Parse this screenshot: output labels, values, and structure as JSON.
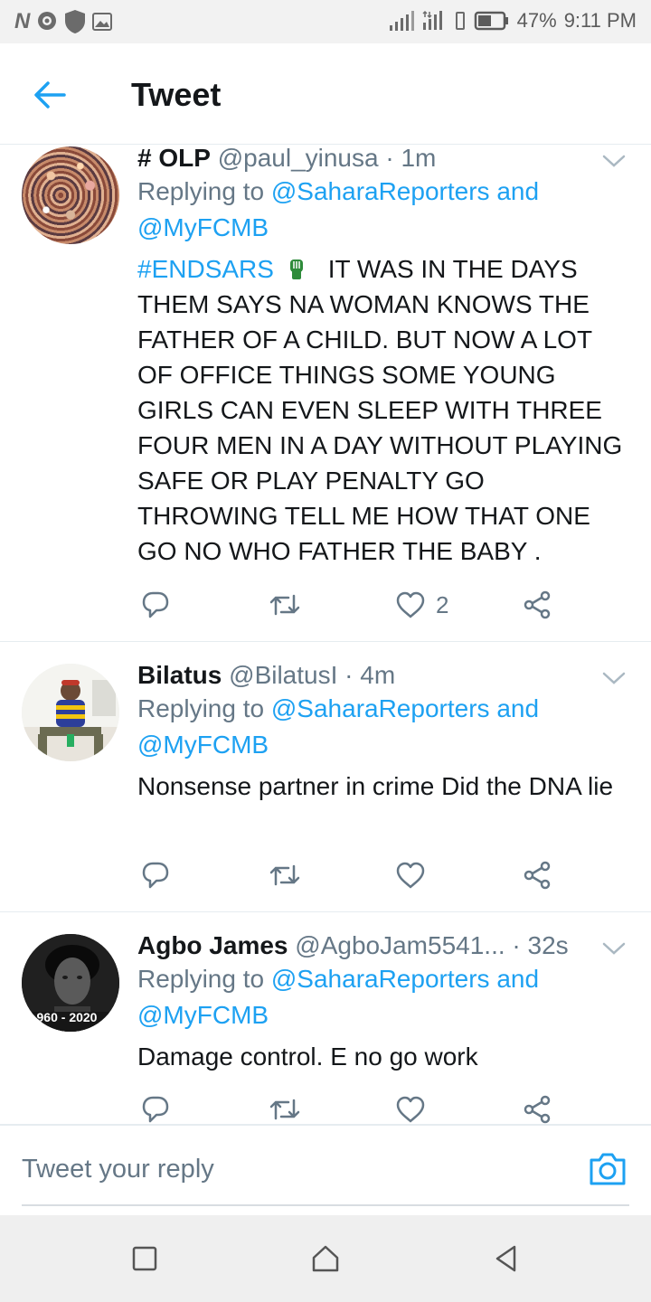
{
  "status_bar": {
    "n_label": "N",
    "battery": "47%",
    "time": "9:11 PM"
  },
  "header": {
    "title": "Tweet"
  },
  "tweets": [
    {
      "name": "# OLP",
      "handle": "@paul_yinusa",
      "separator": "·",
      "time": "1m",
      "replying_prefix": "Replying to",
      "replying_mention1": "@SaharaReporters",
      "replying_and": "and",
      "replying_mention2": "@MyFCMB",
      "hashtag": "#ENDSARS",
      "text": "IT WAS IN THE DAYS THEM SAYS NA WOMAN KNOWS THE FATHER OF A CHILD. BUT NOW A LOT OF OFFICE THINGS  SOME YOUNG GIRLS CAN EVEN SLEEP WITH THREE FOUR MEN  IN A DAY WITHOUT PLAYING SAFE OR PLAY PENALTY GO THROWING  TELL ME HOW THAT ONE GO NO WHO FATHER THE BABY .",
      "like_count": "2"
    },
    {
      "name": "Bilatus",
      "handle": "@BilatusI",
      "separator": "·",
      "time": "4m",
      "replying_prefix": "Replying to",
      "replying_mention1": "@SaharaReporters",
      "replying_and": "and",
      "replying_mention2": "@MyFCMB",
      "text": "Nonsense partner in crime Did the DNA lie"
    },
    {
      "name": "Agbo James",
      "handle": "@AgboJam5541...",
      "separator": "·",
      "time": "32s",
      "replying_prefix": "Replying to",
      "replying_mention1": "@SaharaReporters",
      "replying_and": "and",
      "replying_mention2": "@MyFCMB",
      "avatar_caption": "960 - 2020",
      "text": "Damage control. E no go work"
    }
  ],
  "reply_bar": {
    "placeholder": "Tweet your reply"
  },
  "colors": {
    "accent": "#1da1f2",
    "secondary_text": "#657786",
    "primary_text": "#14171a",
    "divider": "#e6ecf0"
  },
  "icons": [
    "back-arrow-icon",
    "chevron-down-icon",
    "reply-icon",
    "retweet-icon",
    "like-icon",
    "share-icon",
    "fist-emoji-icon",
    "camera-icon",
    "recents-icon",
    "home-icon",
    "back-icon"
  ]
}
